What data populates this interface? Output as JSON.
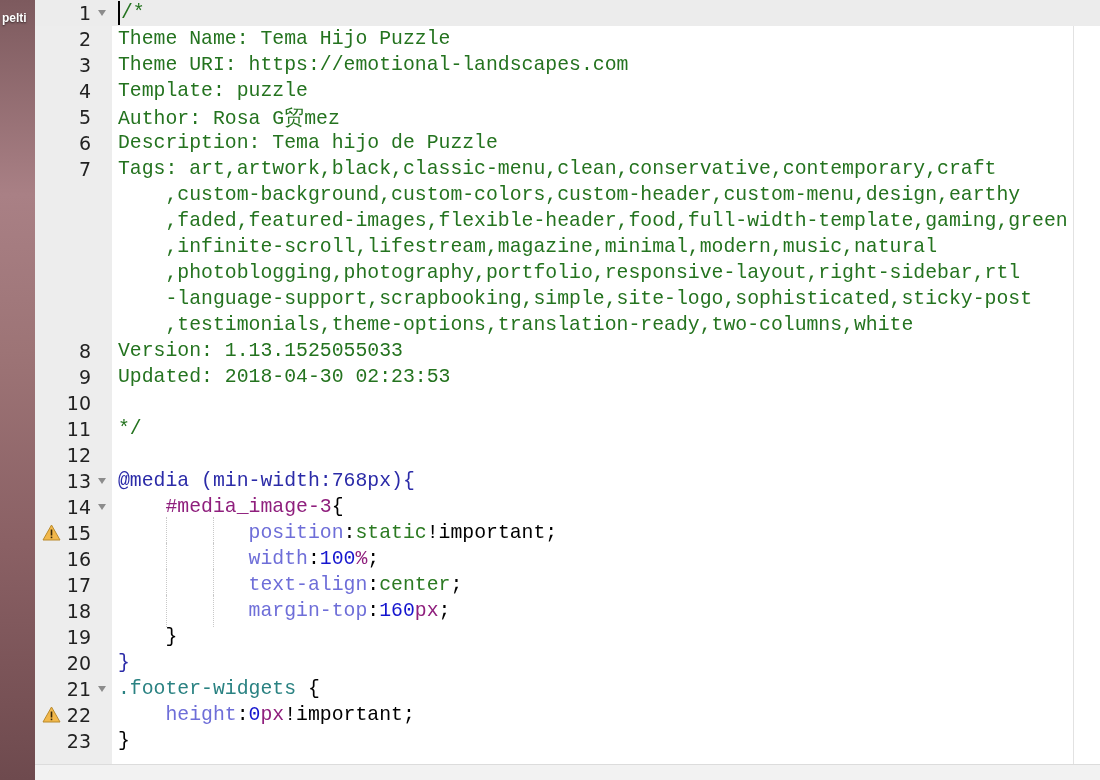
{
  "desktop": {
    "icon_label": "pelti"
  },
  "editor": {
    "lines": [
      {
        "number": "1",
        "fold": true,
        "warning": false,
        "current": true,
        "tokens": [
          {
            "kind": "comment",
            "text": "/*"
          }
        ]
      },
      {
        "number": "2",
        "fold": false,
        "warning": false,
        "current": false,
        "tokens": [
          {
            "kind": "comment",
            "text": "Theme Name: Tema Hijo Puzzle"
          }
        ]
      },
      {
        "number": "3",
        "fold": false,
        "warning": false,
        "current": false,
        "tokens": [
          {
            "kind": "comment",
            "text": "Theme URI: https://emotional-landscapes.com"
          }
        ]
      },
      {
        "number": "4",
        "fold": false,
        "warning": false,
        "current": false,
        "tokens": [
          {
            "kind": "comment",
            "text": "Template: puzzle"
          }
        ]
      },
      {
        "number": "5",
        "fold": false,
        "warning": false,
        "current": false,
        "tokens": [
          {
            "kind": "comment",
            "text": "Author: Rosa G贸mez"
          }
        ]
      },
      {
        "number": "6",
        "fold": false,
        "warning": false,
        "current": false,
        "tokens": [
          {
            "kind": "comment",
            "text": "Description: Tema hijo de Puzzle"
          }
        ]
      },
      {
        "number": "7",
        "fold": false,
        "warning": false,
        "current": false,
        "tokens": [
          {
            "kind": "comment",
            "text": "Tags: art,artwork,black,classic-menu,clean,conservative,contemporary,craft"
          }
        ],
        "wrapped_rows": [
          ",custom-background,custom-colors,custom-header,custom-menu,design,earthy",
          ",faded,featured-images,flexible-header,food,full-width-template,gaming,green",
          ",infinite-scroll,lifestream,magazine,minimal,modern,music,natural",
          ",photoblogging,photography,portfolio,responsive-layout,right-sidebar,rtl",
          "-language-support,scrapbooking,simple,site-logo,sophisticated,sticky-post",
          ",testimonials,theme-options,translation-ready,two-columns,white"
        ]
      },
      {
        "number": "8",
        "fold": false,
        "warning": false,
        "current": false,
        "tokens": [
          {
            "kind": "comment",
            "text": "Version: 1.13.1525055033"
          }
        ]
      },
      {
        "number": "9",
        "fold": false,
        "warning": false,
        "current": false,
        "tokens": [
          {
            "kind": "comment",
            "text": "Updated: 2018-04-30 02:23:53"
          }
        ]
      },
      {
        "number": "10",
        "fold": false,
        "warning": false,
        "current": false
      },
      {
        "number": "11",
        "fold": false,
        "warning": false,
        "current": false,
        "tokens": [
          {
            "kind": "comment",
            "text": "*/"
          }
        ]
      },
      {
        "number": "12",
        "fold": false,
        "warning": false,
        "current": false
      },
      {
        "number": "13",
        "fold": true,
        "warning": false,
        "current": false,
        "tokens": [
          {
            "kind": "at-rule",
            "text": "@media (min-width:768px){"
          }
        ],
        "children": [
          {
            "number": "14",
            "fold": true,
            "warning": false,
            "current": false,
            "tokens": [
              {
                "kind": "id-selector",
                "text": "#media_image-3"
              },
              {
                "kind": "punct",
                "text": "{"
              }
            ],
            "children": [
              {
                "number": "15",
                "fold": false,
                "warning": true,
                "current": false,
                "tokens": [
                  {
                    "kind": "property",
                    "text": "position"
                  },
                  {
                    "kind": "punct",
                    "text": ":"
                  },
                  {
                    "kind": "value",
                    "text": "static"
                  },
                  {
                    "kind": "punct",
                    "text": "!important;"
                  }
                ]
              },
              {
                "number": "16",
                "fold": false,
                "warning": false,
                "current": false,
                "tokens": [
                  {
                    "kind": "property",
                    "text": "width"
                  },
                  {
                    "kind": "punct",
                    "text": ":"
                  },
                  {
                    "kind": "number",
                    "text": "100"
                  },
                  {
                    "kind": "unit",
                    "text": "%"
                  },
                  {
                    "kind": "punct",
                    "text": ";"
                  }
                ]
              },
              {
                "number": "17",
                "fold": false,
                "warning": false,
                "current": false,
                "tokens": [
                  {
                    "kind": "property",
                    "text": "text-align"
                  },
                  {
                    "kind": "punct",
                    "text": ":"
                  },
                  {
                    "kind": "value",
                    "text": "center"
                  },
                  {
                    "kind": "punct",
                    "text": ";"
                  }
                ]
              },
              {
                "number": "18",
                "fold": false,
                "warning": false,
                "current": false,
                "tokens": [
                  {
                    "kind": "property",
                    "text": "margin-top"
                  },
                  {
                    "kind": "punct",
                    "text": ":"
                  },
                  {
                    "kind": "number",
                    "text": "160"
                  },
                  {
                    "kind": "unit",
                    "text": "px"
                  },
                  {
                    "kind": "punct",
                    "text": ";"
                  }
                ]
              }
            ]
          },
          {
            "number": "19",
            "fold": false,
            "warning": false,
            "current": false,
            "tokens": [
              {
                "kind": "punct",
                "text": "}"
              }
            ]
          }
        ]
      },
      {
        "number": "20",
        "fold": false,
        "warning": false,
        "current": false,
        "tokens": [
          {
            "kind": "brace",
            "text": "}"
          }
        ]
      },
      {
        "number": "21",
        "fold": true,
        "warning": false,
        "current": false,
        "tokens": [
          {
            "kind": "class-selector",
            "text": ".footer-widgets"
          },
          {
            "kind": "punct",
            "text": " {"
          }
        ],
        "children": [
          {
            "number": "22",
            "fold": false,
            "warning": true,
            "current": false,
            "tokens": [
              {
                "kind": "property",
                "text": "height"
              },
              {
                "kind": "punct",
                "text": ":"
              },
              {
                "kind": "number",
                "text": "0"
              },
              {
                "kind": "unit",
                "text": "px"
              },
              {
                "kind": "punct",
                "text": "!important;"
              }
            ]
          }
        ]
      },
      {
        "number": "23",
        "fold": false,
        "warning": false,
        "current": false,
        "tokens": [
          {
            "kind": "punct",
            "text": "}"
          }
        ]
      }
    ]
  }
}
